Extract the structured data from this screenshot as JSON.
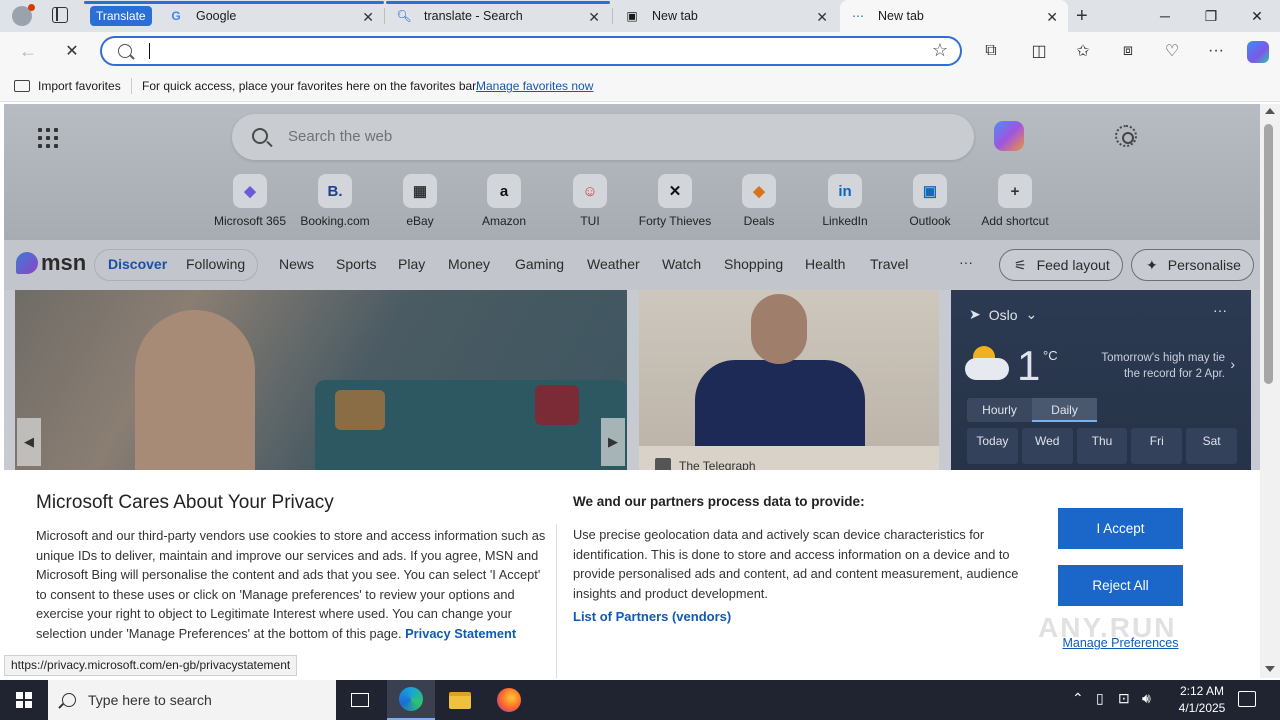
{
  "tabs": {
    "group_label": "Translate",
    "items": [
      {
        "title": "Google",
        "icon": "google-icon"
      },
      {
        "title": "translate - Search",
        "icon": "search-icon"
      },
      {
        "title": "New tab",
        "icon": "newtab-icon"
      },
      {
        "title": "New tab",
        "icon": "loading-icon"
      }
    ]
  },
  "address_bar": {
    "value": "",
    "placeholder": ""
  },
  "favorites_bar": {
    "import_label": "Import favorites",
    "message": "For quick access, place your favorites here on the favorites bar.",
    "manage_link": "Manage favorites now"
  },
  "ntp": {
    "search_placeholder": "Search the web",
    "shortcuts": [
      {
        "label": "Microsoft 365",
        "glyph": "◆",
        "color": "#6b5bd6"
      },
      {
        "label": "Booking.com",
        "glyph": "B.",
        "color": "#1f3f8f"
      },
      {
        "label": "eBay",
        "glyph": "▦",
        "color": "#333333"
      },
      {
        "label": "Amazon",
        "glyph": "a",
        "color": "#111111"
      },
      {
        "label": "TUI",
        "glyph": "☺",
        "color": "#d23b3b"
      },
      {
        "label": "Forty Thieves",
        "glyph": "✕",
        "color": "#111111"
      },
      {
        "label": "Deals",
        "glyph": "◆",
        "color": "#d8721b"
      },
      {
        "label": "LinkedIn",
        "glyph": "in",
        "color": "#0a66c2"
      },
      {
        "label": "Outlook",
        "glyph": "▣",
        "color": "#0f6cbd"
      },
      {
        "label": "Add shortcut",
        "glyph": "+",
        "color": "#333333"
      }
    ]
  },
  "msn": {
    "logo_text": "msn",
    "nav": [
      "Discover",
      "Following",
      "News",
      "Sports",
      "Play",
      "Money",
      "Gaming",
      "Weather",
      "Watch",
      "Shopping",
      "Health",
      "Travel"
    ],
    "more": "···",
    "feed_layout": "Feed layout",
    "personalise": "Personalise",
    "card2_source": "The Telegraph"
  },
  "weather": {
    "city": "Oslo",
    "temp": "1",
    "unit": "°C",
    "note": "Tomorrow's high may tie the record for 2 Apr.",
    "tabs": [
      "Hourly",
      "Daily"
    ],
    "days": [
      "Today",
      "Wed",
      "Thu",
      "Fri",
      "Sat"
    ]
  },
  "consent": {
    "title": "Microsoft Cares About Your Privacy",
    "left_text": "Microsoft and our third-party vendors use cookies to store and access information such as unique IDs to deliver, maintain and improve our services and ads. If you agree, MSN and Microsoft Bing will personalise the content and ads that you see. You can select 'I Accept' to consent to these uses or click on 'Manage preferences' to review your options and exercise your right to object to Legitimate Interest where used.  You can change your selection under 'Manage Preferences' at the bottom of this page.",
    "privacy_link": "Privacy Statement",
    "right_title": "We and our partners process data to provide:",
    "right_text": "Use precise geolocation data and actively scan device characteristics for identification. This is done to store and access information on a device and to provide personalised ads and content, ad and content measurement, audience insights and product development.",
    "partners_link": "List of Partners (vendors)",
    "accept": "I Accept",
    "reject": "Reject All",
    "manage": "Manage Preferences"
  },
  "status_url": "https://privacy.microsoft.com/en-gb/privacystatement",
  "watermark": "ANY.RUN",
  "taskbar": {
    "search_placeholder": "Type here to search",
    "time": "2:12 AM",
    "date": "4/1/2025"
  }
}
